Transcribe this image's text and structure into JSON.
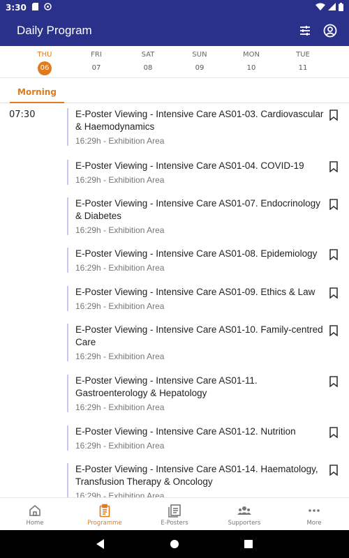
{
  "status_bar": {
    "time": "3:30"
  },
  "header": {
    "title": "Daily Program",
    "filter_icon": "sliders-icon",
    "profile_icon": "account-circle-icon"
  },
  "days": [
    {
      "name": "THU",
      "num": "06",
      "active": true
    },
    {
      "name": "FRI",
      "num": "07"
    },
    {
      "name": "SAT",
      "num": "08"
    },
    {
      "name": "SUN",
      "num": "09"
    },
    {
      "name": "MON",
      "num": "10"
    },
    {
      "name": "TUE",
      "num": "11"
    }
  ],
  "period_tab": "Morning",
  "time_slot": "07:30",
  "sessions": [
    {
      "title": "E-Poster Viewing - Intensive Care AS01-03. Cardiovascular & Haemodynamics",
      "meta": "16:29h - Exhibition Area"
    },
    {
      "title": "E-Poster Viewing - Intensive Care AS01-04. COVID-19",
      "meta": "16:29h - Exhibition Area"
    },
    {
      "title": "E-Poster Viewing - Intensive Care AS01-07. Endocrinology & Diabetes",
      "meta": "16:29h - Exhibition Area"
    },
    {
      "title": "E-Poster Viewing - Intensive Care AS01-08. Epidemiology",
      "meta": "16:29h - Exhibition Area"
    },
    {
      "title": "E-Poster Viewing - Intensive Care AS01-09. Ethics & Law",
      "meta": "16:29h - Exhibition Area"
    },
    {
      "title": "E-Poster Viewing - Intensive Care AS01-10. Family-centred Care",
      "meta": "16:29h - Exhibition Area"
    },
    {
      "title": "E-Poster Viewing - Intensive Care AS01-11. Gastroenterology & Hepatology",
      "meta": "16:29h - Exhibition Area"
    },
    {
      "title": "E-Poster Viewing - Intensive Care AS01-12. Nutrition",
      "meta": "16:29h - Exhibition Area"
    },
    {
      "title": "E-Poster Viewing - Intensive Care AS01-14. Haematology, Transfusion Therapy & Oncology",
      "meta": "16:29h - Exhibition Area"
    }
  ],
  "bottom_nav": [
    {
      "label": "Home",
      "icon": "home-icon"
    },
    {
      "label": "Programme",
      "icon": "clipboard-icon",
      "active": true
    },
    {
      "label": "E-Posters",
      "icon": "posters-icon"
    },
    {
      "label": "Supporters",
      "icon": "people-icon"
    },
    {
      "label": "More",
      "icon": "more-dots-icon"
    }
  ],
  "colors": {
    "primary": "#2a318a",
    "accent": "#e07a1c",
    "session_bar": "#c7c8ee"
  }
}
